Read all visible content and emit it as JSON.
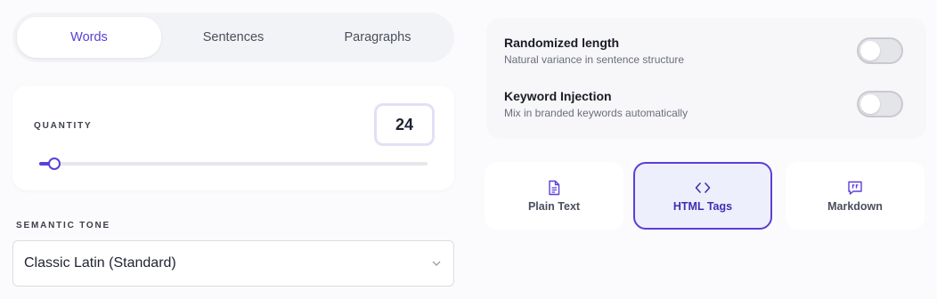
{
  "mode_tabs": [
    {
      "label": "Words",
      "active": true
    },
    {
      "label": "Sentences",
      "active": false
    },
    {
      "label": "Paragraphs",
      "active": false
    }
  ],
  "quantity": {
    "label": "QUANTITY",
    "value": "24",
    "slider_fraction": 0.04
  },
  "tone": {
    "label": "SEMANTIC TONE",
    "selected": "Classic Latin (Standard)"
  },
  "options": [
    {
      "title": "Randomized length",
      "subtitle": "Natural variance in sentence structure",
      "enabled": false
    },
    {
      "title": "Keyword Injection",
      "subtitle": "Mix in branded keywords automatically",
      "enabled": false
    }
  ],
  "formats": [
    {
      "label": "Plain Text",
      "icon": "document-icon",
      "active": false
    },
    {
      "label": "HTML Tags",
      "icon": "code-icon",
      "active": true
    },
    {
      "label": "Markdown",
      "icon": "quote-bubble-icon",
      "active": false
    }
  ],
  "colors": {
    "accent": "#5b3fd6",
    "background": "#fbfbfd"
  }
}
